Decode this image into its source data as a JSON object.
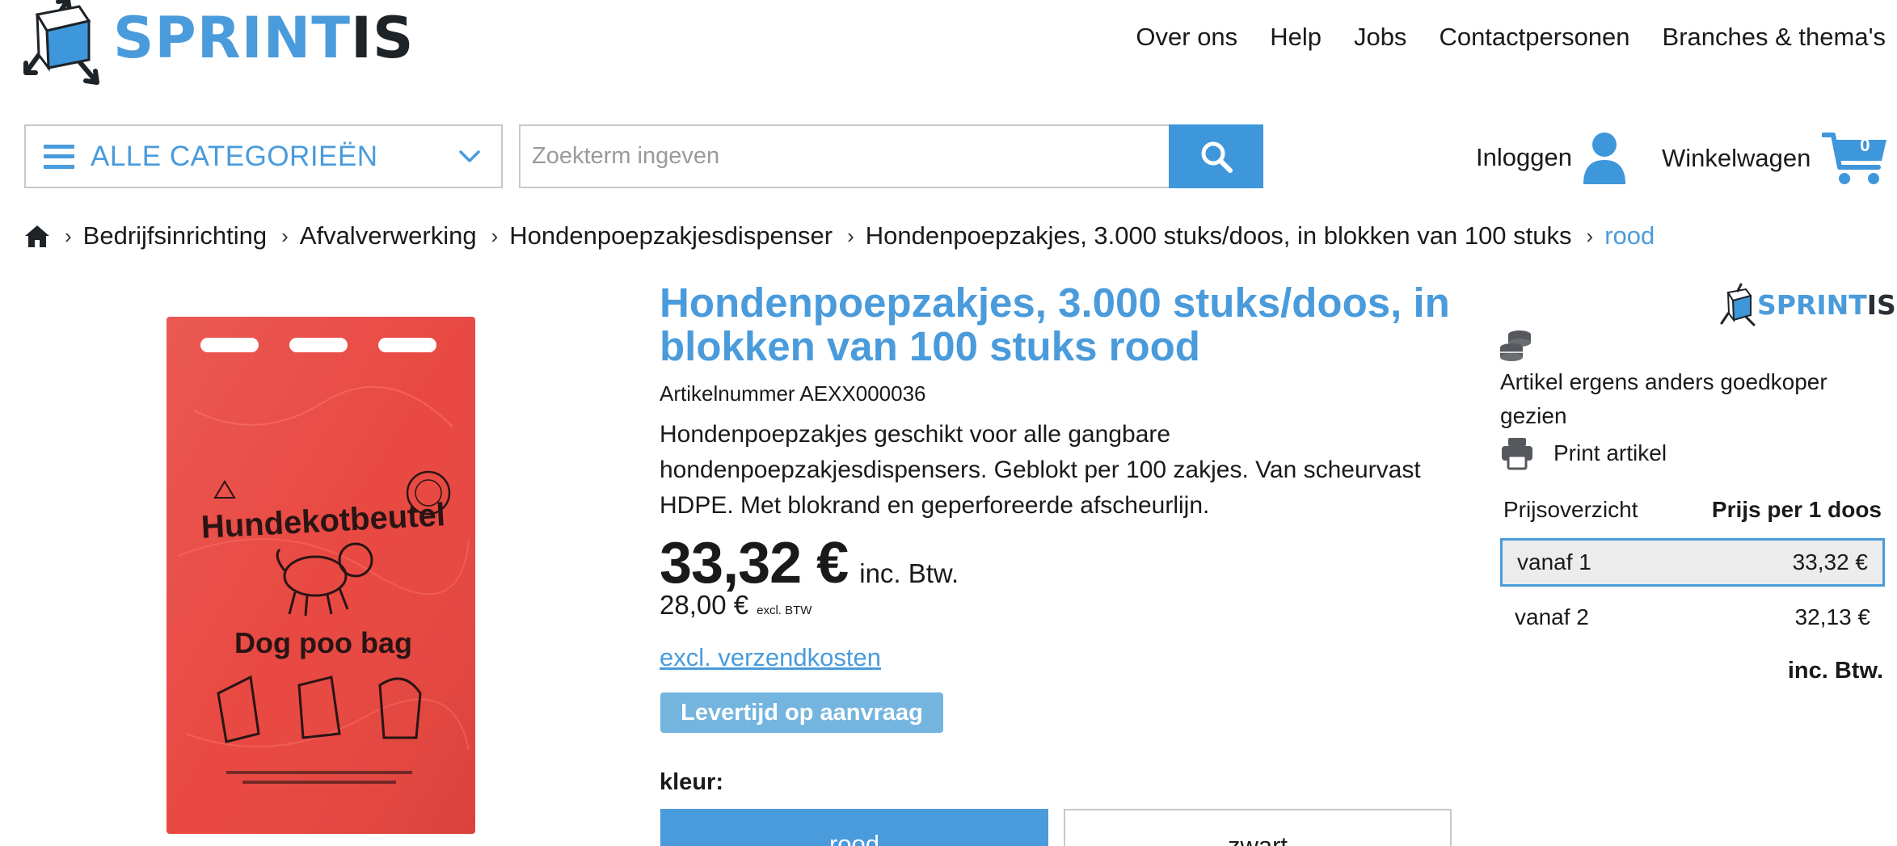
{
  "brand": {
    "part1": "SPRINT",
    "part2": "IS",
    "accent": "#4a9bdb"
  },
  "top_nav": [
    "Over ons",
    "Help",
    "Jobs",
    "Contactpersonen",
    "Branches & thema's"
  ],
  "categories": {
    "label": "ALLE CATEGORIEËN"
  },
  "search": {
    "placeholder": "Zoekterm ingeven"
  },
  "account": {
    "login_label": "Inloggen"
  },
  "cart": {
    "label": "Winkelwagen",
    "count": "0"
  },
  "breadcrumb": [
    "Bedrijfsinrichting",
    "Afvalverwerking",
    "Hondenpoepzakjesdispenser",
    "Hondenpoepzakjes, 3.000 stuks/doos, in blokken van 100 stuks",
    "rood"
  ],
  "product": {
    "title": "Hondenpoepzakjes, 3.000 stuks/doos, in blokken van 100 stuks rood",
    "article_number": "Artikelnummer AEXX000036",
    "description": "Hondenpoepzakjes geschikt voor alle gangbare hondenpoepzakjesdispensers. Geblokt per 100 zakjes. Van scheurvast HDPE. Met blokrand en geperforeerde afscheurlijn.",
    "price_incl": "33,32 €",
    "price_incl_label": "inc. Btw.",
    "price_excl": "28,00 €",
    "price_excl_label": "excl. BTW",
    "shipping_link": "excl. verzendkosten",
    "delivery_badge": "Levertijd op aanvraag",
    "color_label": "kleur:",
    "colors": [
      "rood",
      "zwart"
    ],
    "image": {
      "bag_color": "#e8463f",
      "print_title": "Hundekotbeutel",
      "print_subtitle": "Dog poo bag"
    }
  },
  "sidebar": {
    "cheaper_text": "Artikel ergens anders goedkoper gezien",
    "print_label": "Print artikel",
    "price_overview_label": "Prijsoverzicht",
    "price_per_label": "Prijs per 1 doos",
    "tiers": [
      {
        "label": "vanaf 1",
        "price": "33,32 €"
      },
      {
        "label": "vanaf 2",
        "price": "32,13 €"
      }
    ],
    "tax_note": "inc. Btw."
  }
}
